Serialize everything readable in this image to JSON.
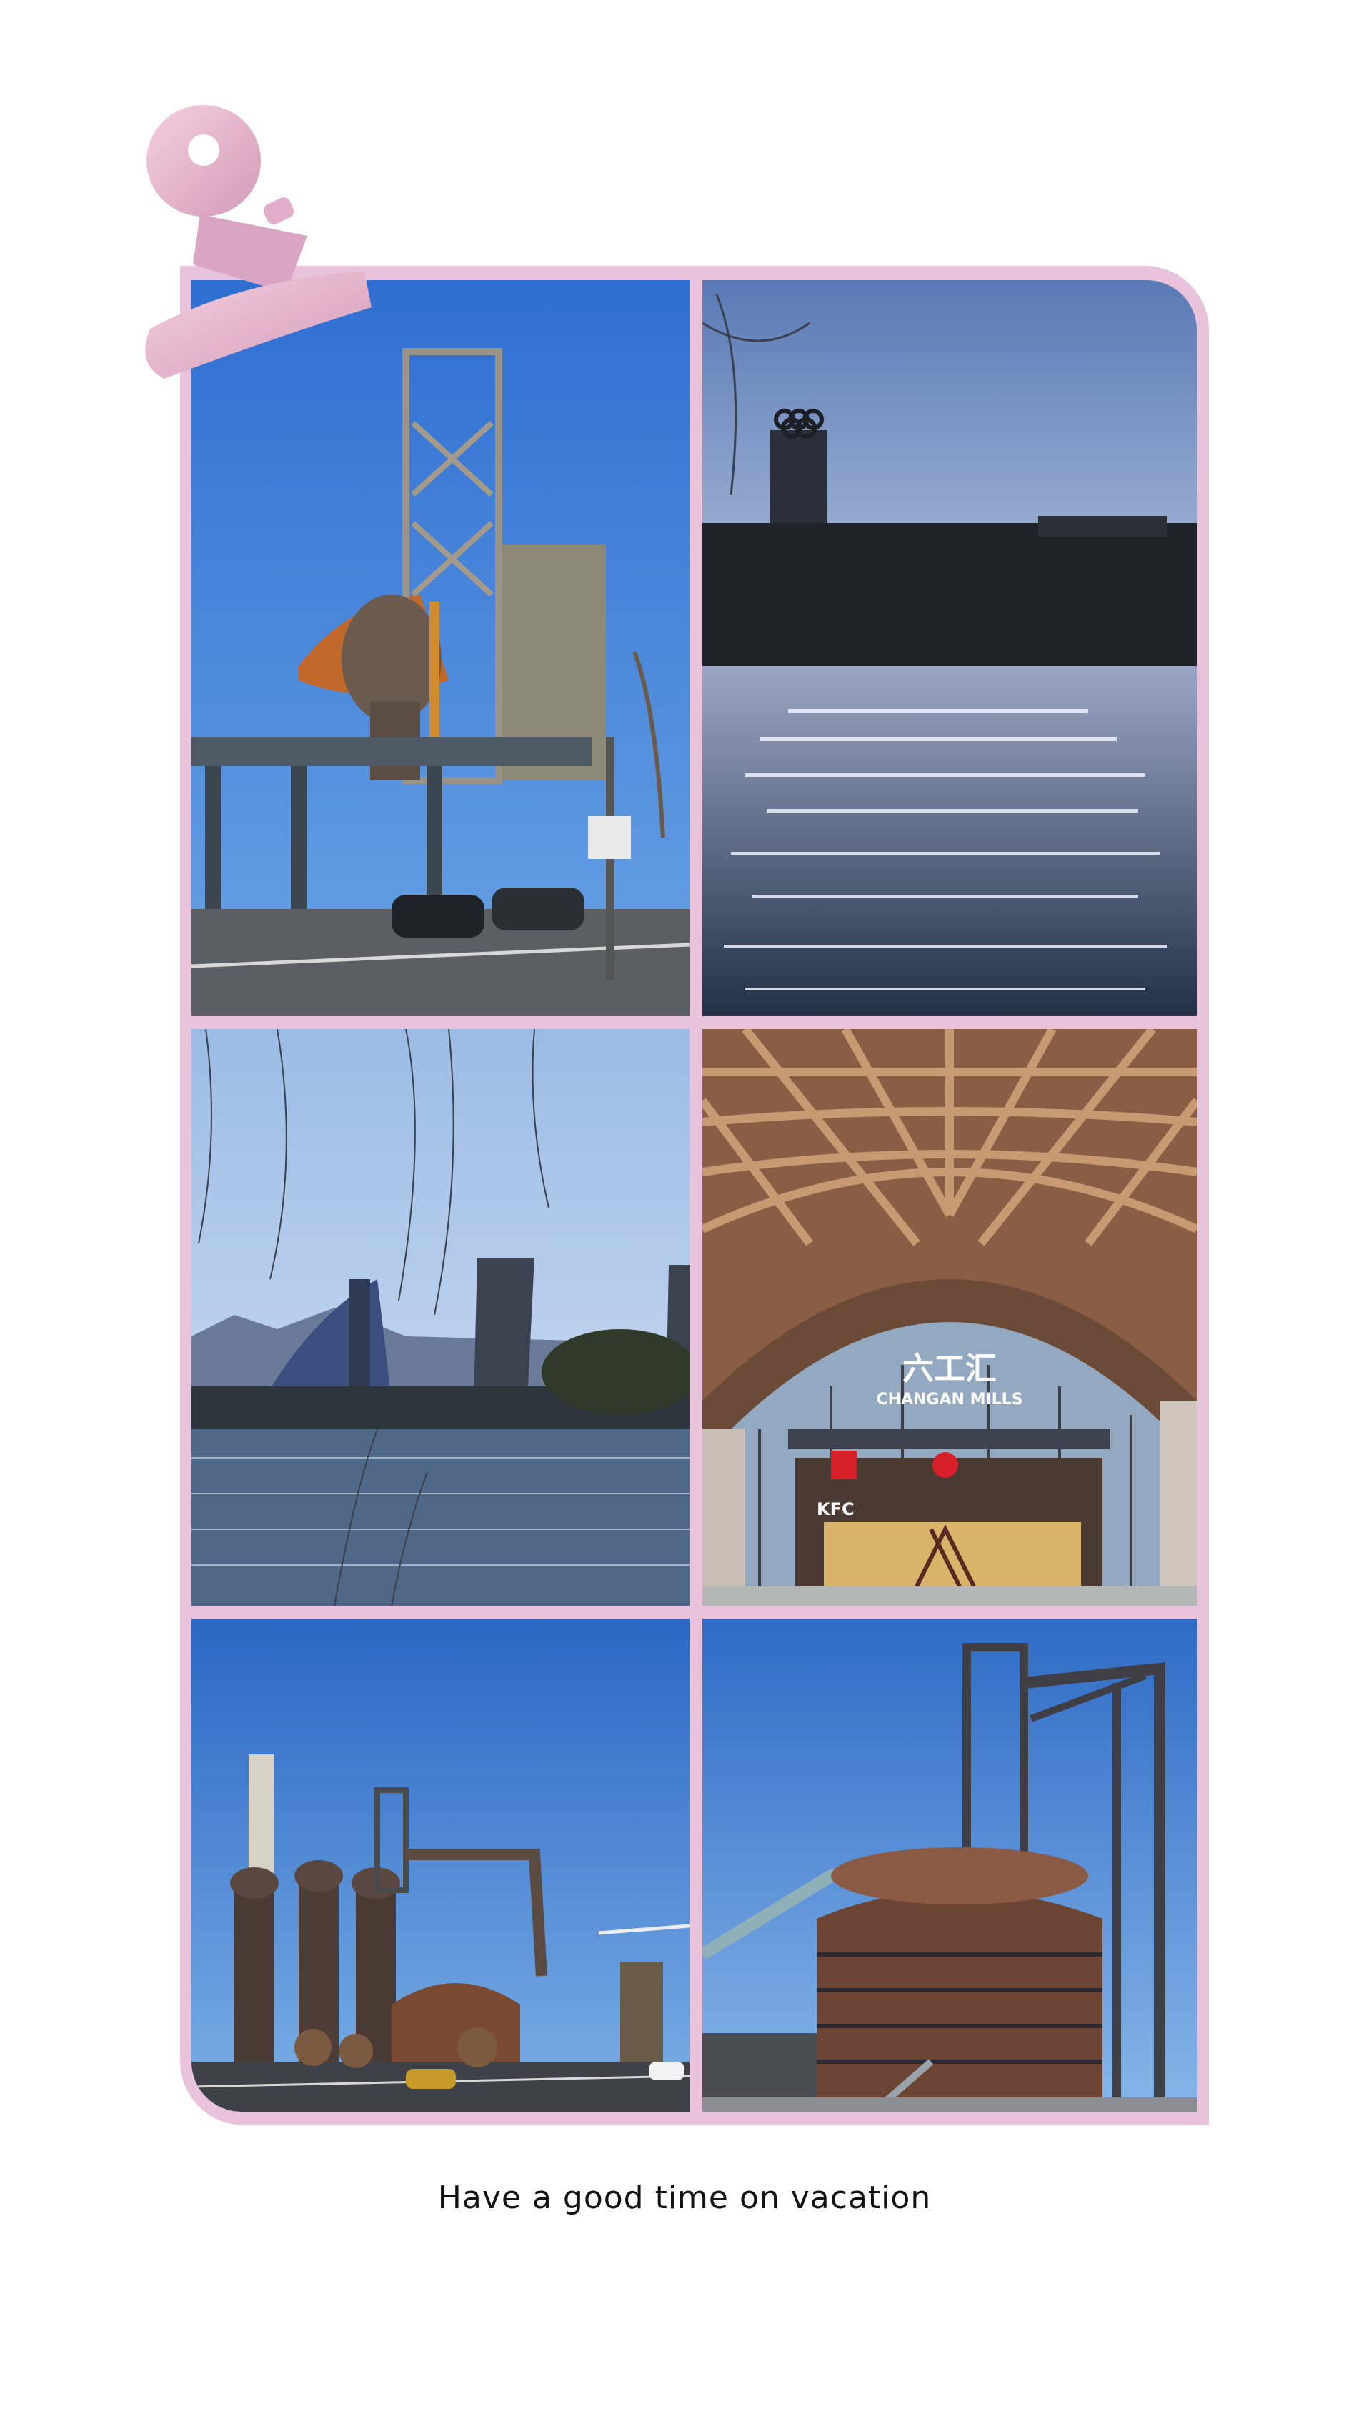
{
  "caption": "Have a good time on vacation",
  "photos": [
    {
      "subject": "blast furnace tower and bus stop"
    },
    {
      "subject": "sparkling lake with Olympic rings tower"
    },
    {
      "subject": "cooling towers and ski jump by river"
    },
    {
      "subject": "wooden arched hall entrance"
    },
    {
      "subject": "furnaces and chimney along street"
    },
    {
      "subject": "round rusted furnace building"
    }
  ],
  "signage": {
    "mall_cn": "六工汇",
    "mall_en": "CHANGAN MILLS",
    "kfc": "KFC"
  },
  "colors": {
    "frame": "#e9c3db",
    "clip": "#e8b3cc",
    "sky": "#3c78c8"
  }
}
